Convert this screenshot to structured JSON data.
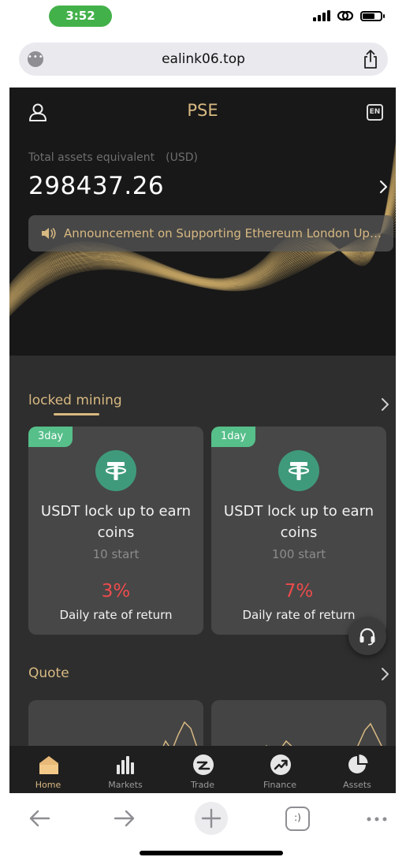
{
  "status_bar": {
    "time": "3:52",
    "accent_color": "#43b14a"
  },
  "browser": {
    "url": "ealink06.top",
    "more_icon": "ellipsis-circle-icon",
    "share_icon": "share-icon"
  },
  "app": {
    "title": "PSE",
    "language_badge": "EN",
    "accent_color": "#d8b982",
    "total_assets": {
      "label": "Total assets equivalent　(USD)",
      "value": "298437.26"
    },
    "announcement": {
      "text": "Announcement on Supporting Ethereum London Upgrade"
    },
    "locked_mining": {
      "title": "locked mining",
      "cards": [
        {
          "duration": "3day",
          "title": "USDT lock up to earn coins",
          "start": "10 start",
          "rate": "3%",
          "rate_label": "Daily rate of return"
        },
        {
          "duration": "1day",
          "title": "USDT lock up to earn coins",
          "start": "100 start",
          "rate": "7%",
          "rate_label": "Daily rate of return"
        }
      ]
    },
    "quote": {
      "title": "Quote"
    },
    "tabs": [
      {
        "label": "Home",
        "icon": "home-icon",
        "active": true
      },
      {
        "label": "Markets",
        "icon": "bar-chart-icon",
        "active": false
      },
      {
        "label": "Trade",
        "icon": "trade-icon",
        "active": false
      },
      {
        "label": "Finance",
        "icon": "trend-arrow-icon",
        "active": false
      },
      {
        "label": "Assets",
        "icon": "pie-chart-icon",
        "active": false
      }
    ]
  },
  "browser_toolbar": {
    "tabs_count": ":)"
  }
}
